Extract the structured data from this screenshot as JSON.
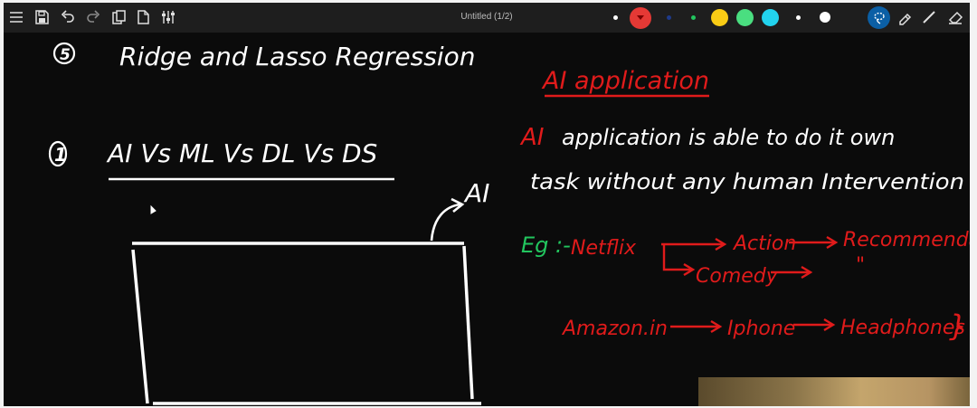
{
  "toolbar": {
    "title": "Untitled (1/2)",
    "left_icons": [
      "menu-icon",
      "save-icon",
      "undo-icon",
      "redo-icon",
      "paste-icon",
      "page-icon",
      "settings-sliders-icon"
    ],
    "right_icons": [
      "lasso-select-icon",
      "highlighter-icon",
      "pen-icon",
      "eraser-icon"
    ],
    "colors": [
      "#ffffff",
      "#e53935",
      "#1e3a8a",
      "#22c55e",
      "#facc15",
      "#4ade80",
      "#22d3ee",
      "#ffffff",
      "#ffffff",
      "#0b5fa5"
    ]
  },
  "board": {
    "heading_num": "5",
    "heading": "Ridge and Lasso Regression",
    "item_num": "1",
    "item": "AI Vs ML Vs DL Vs DS",
    "ai_label": "AI",
    "app_title": "AI application",
    "line1_ai": "AI",
    "line1_rest": "application is able to do it own",
    "line2": "task without any human Intervention",
    "eg": "Eg :-",
    "netflix": "Netflix",
    "action": "Action",
    "comedy": "Comedy",
    "recommend": "Recommendation",
    "ditto": "\"",
    "amazon": "Amazon.in",
    "iphone": "Iphone",
    "headphones": "Headphones",
    "brace": "}"
  }
}
